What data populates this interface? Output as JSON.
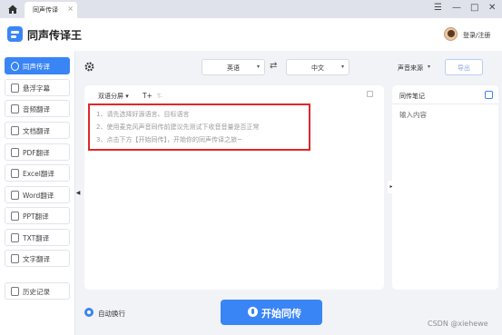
{
  "titlebar": {
    "tab_label": "同声传译",
    "tab_close": "×",
    "menu_icon": "☰",
    "minimize_icon": "—",
    "maximize_icon": "□",
    "close_icon": "✕"
  },
  "header": {
    "app_title": "同声传译王",
    "login_label": "登录/注册"
  },
  "sidebar": {
    "items": [
      {
        "label": "同声传译",
        "icon": "headset-icon",
        "active": true
      },
      {
        "label": "悬浮字幕",
        "icon": "subtitle-icon"
      },
      {
        "label": "音频翻译",
        "icon": "audio-icon"
      },
      {
        "label": "文档翻译",
        "icon": "document-icon"
      },
      {
        "label": "PDF翻译",
        "icon": "pdf-icon"
      },
      {
        "label": "Excel翻译",
        "icon": "excel-icon"
      },
      {
        "label": "Word翻译",
        "icon": "word-icon"
      },
      {
        "label": "PPT翻译",
        "icon": "ppt-icon"
      },
      {
        "label": "TXT翻译",
        "icon": "txt-icon"
      },
      {
        "label": "文字翻译",
        "icon": "text-icon"
      },
      {
        "label": "历史记录",
        "icon": "history-icon"
      }
    ],
    "collapse_arrow": "◀"
  },
  "toolbar": {
    "source_lang": "英语",
    "target_lang": "中文",
    "caret": "▾",
    "swap_icon": "⇄",
    "audio_source_label": "声音来源",
    "export_label": "导出"
  },
  "main_panel": {
    "mode_label": "双语分屏 ▾",
    "font_increase": "T+",
    "font_decrease": "T-",
    "hints": [
      "1、请先选择好源语言、目标语言",
      "2、使用麦克风声音同传前建议先测试下收音音量是否正常",
      "3、点击下方【开始同传】，开始你的同声传译之旅~"
    ]
  },
  "panel_toggle": "▸",
  "notes": {
    "title": "同传笔记",
    "input_placeholder": "输入内容"
  },
  "bottom": {
    "auto_wrap_label": "自动换行",
    "start_label": "开始同传"
  },
  "watermark": "CSDN @xiehewe",
  "colors": {
    "accent": "#3a85f5",
    "highlight_border": "#e0272b"
  }
}
